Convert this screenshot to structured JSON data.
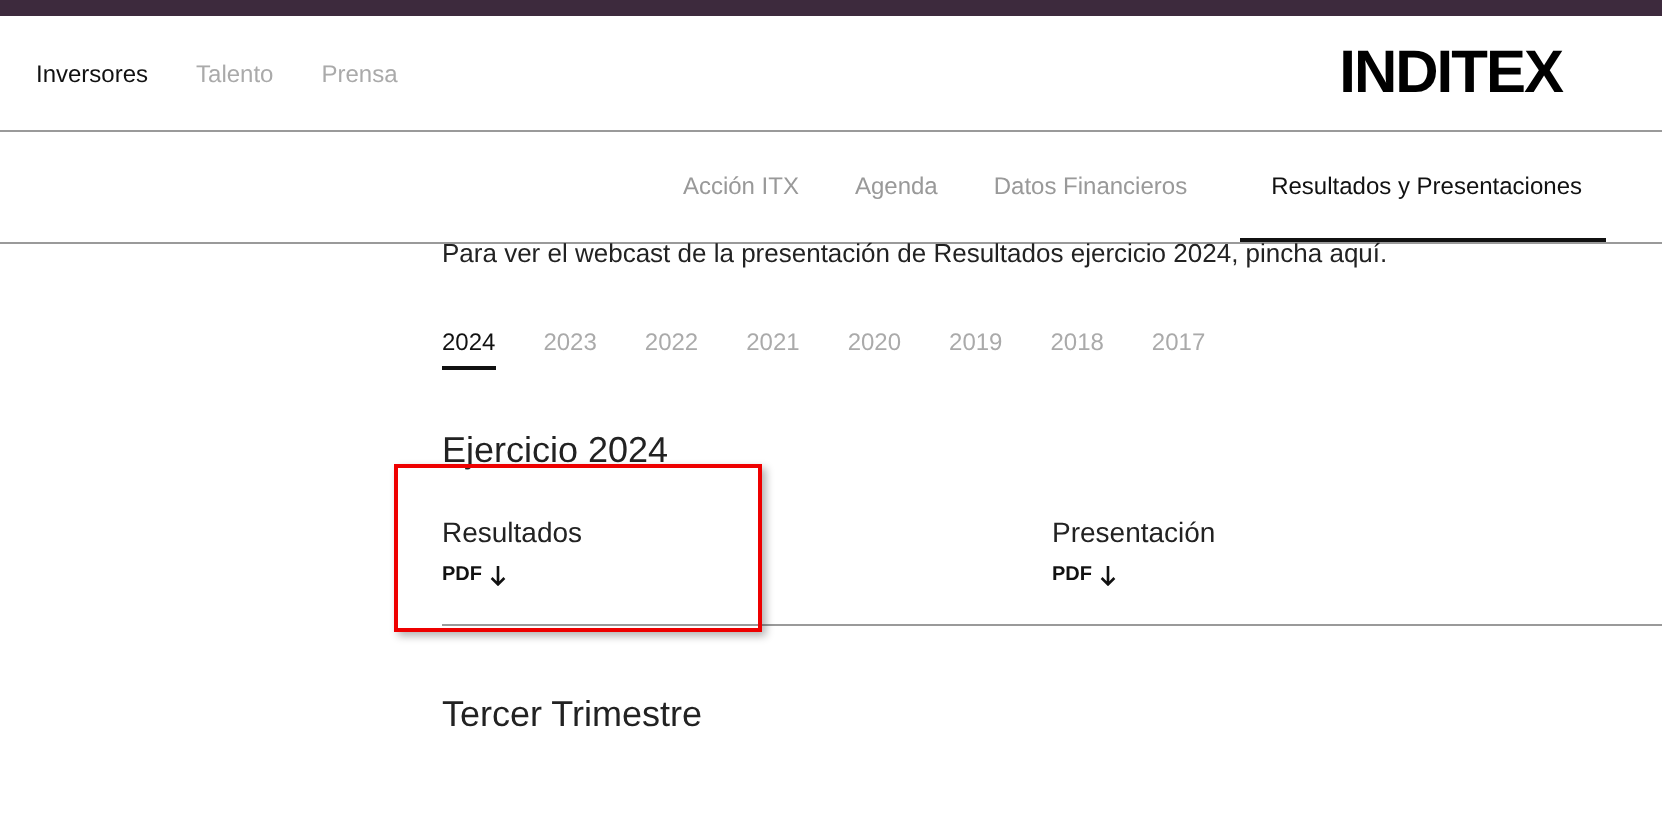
{
  "header": {
    "links": [
      {
        "label": "Inversores",
        "selected": true
      },
      {
        "label": "Talento",
        "selected": false
      },
      {
        "label": "Prensa",
        "selected": false
      }
    ],
    "logo": "INDITEX"
  },
  "subnav": [
    {
      "label": "Acción ITX",
      "selected": false
    },
    {
      "label": "Agenda",
      "selected": false
    },
    {
      "label": "Datos Financieros",
      "selected": false
    },
    {
      "label": "Resultados y Presentaciones",
      "selected": true
    }
  ],
  "webcast": {
    "text": "Para ver el webcast de la presentación de Resultados ejercicio 2024, pincha ",
    "link": "aquí",
    "end": "."
  },
  "years": [
    {
      "label": "2024",
      "selected": true
    },
    {
      "label": "2023",
      "selected": false
    },
    {
      "label": "2022",
      "selected": false
    },
    {
      "label": "2021",
      "selected": false
    },
    {
      "label": "2020",
      "selected": false
    },
    {
      "label": "2019",
      "selected": false
    },
    {
      "label": "2018",
      "selected": false
    },
    {
      "label": "2017",
      "selected": false
    }
  ],
  "sections": [
    {
      "title": "Ejercicio 2024",
      "documents": [
        {
          "title": "Resultados",
          "format": "PDF",
          "highlighted": true
        },
        {
          "title": "Presentación",
          "format": "PDF",
          "highlighted": false
        }
      ]
    },
    {
      "title": "Tercer Trimestre"
    }
  ]
}
